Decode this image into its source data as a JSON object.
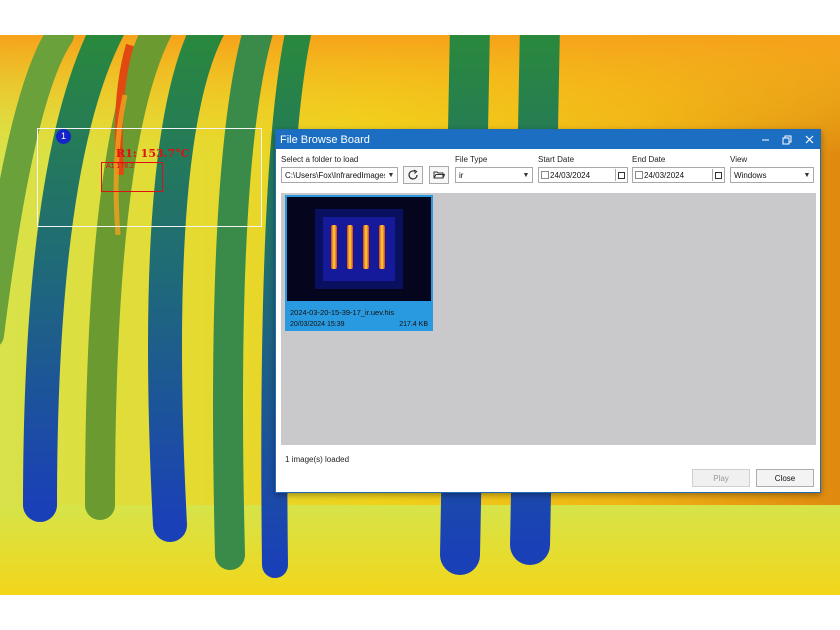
{
  "overlay": {
    "roi_number": "1",
    "roi_label": "R1: 153.7°C",
    "roi_sublabel": "A1 178.2"
  },
  "dialog": {
    "title": "File Browse Board",
    "folder_label": "Select a folder to load",
    "folder_value": "C:\\Users\\Fox\\InfraredImages",
    "file_type_label": "File Type",
    "file_type_value": "ir",
    "start_date_label": "Start Date",
    "start_date_value": "24/03/2024",
    "end_date_label": "End Date",
    "end_date_value": "24/03/2024",
    "view_label": "View",
    "view_value": "Windows",
    "thumbnail": {
      "filename": "2024-03-20-15-39-17_ir.uev.his",
      "datetime": "20/03/2024 15:39",
      "size": "217.4 KB"
    },
    "status": "1 image(s) loaded",
    "play_label": "Play",
    "close_label": "Close"
  },
  "icons": {
    "minimize": "minimize-icon",
    "maximize": "restore-icon",
    "close": "close-icon",
    "refresh": "refresh-icon",
    "open_folder": "folder-open-icon"
  }
}
